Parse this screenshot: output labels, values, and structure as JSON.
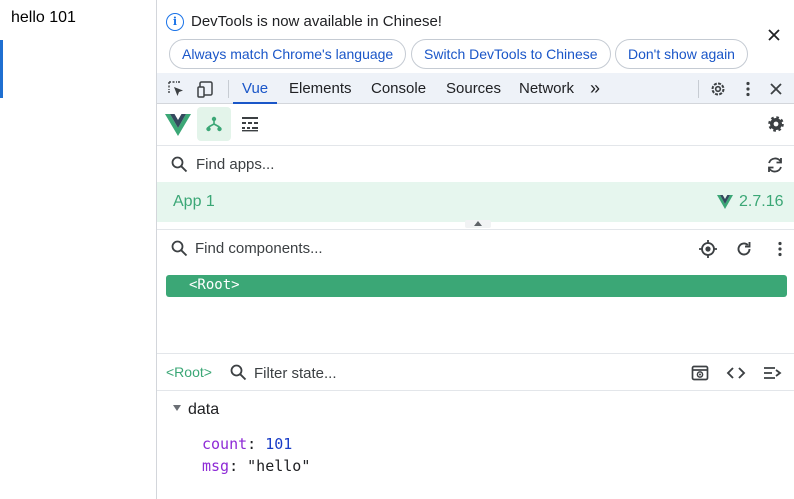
{
  "page": {
    "text": "hello 101"
  },
  "infobar": {
    "message": "DevTools is now available in Chinese!",
    "buttons": [
      "Always match Chrome's language",
      "Switch DevTools to Chinese",
      "Don't show again"
    ]
  },
  "tabs": {
    "items": [
      "Vue",
      "Elements",
      "Console",
      "Sources",
      "Network"
    ],
    "active": "Vue",
    "more": "»"
  },
  "find_apps": {
    "placeholder": "Find apps..."
  },
  "app": {
    "name": "App 1",
    "version": "2.7.16"
  },
  "find_components": {
    "placeholder": "Find components..."
  },
  "tree": {
    "root": "<Root>"
  },
  "state_bar": {
    "component": "<Root>",
    "placeholder": "Filter state..."
  },
  "state": {
    "section": "data",
    "props": [
      {
        "key": "count",
        "value": "101",
        "kind": "number"
      },
      {
        "key": "msg",
        "value": "\"hello\"",
        "kind": "string"
      }
    ]
  },
  "colors": {
    "vue_green": "#3ba776",
    "accent_blue": "#1a56c8",
    "key_purple": "#8e2ad6"
  },
  "icons": {
    "infobar": "info-icon",
    "tabstrip": [
      "inspect-element-icon",
      "device-toolbar-icon",
      "more-tabs-chevron-icon",
      "gear-icon",
      "kebab-menu-icon",
      "close-icon"
    ],
    "vue_toolbar": [
      "vue-logo-icon",
      "component-tree-icon",
      "timeline-icon",
      "settings-gear-icon"
    ],
    "components": [
      "search-icon",
      "target-icon",
      "refresh-icon",
      "kebab-menu-icon"
    ],
    "state": [
      "search-icon",
      "open-in-editor-icon",
      "code-icon",
      "format-icon"
    ]
  }
}
